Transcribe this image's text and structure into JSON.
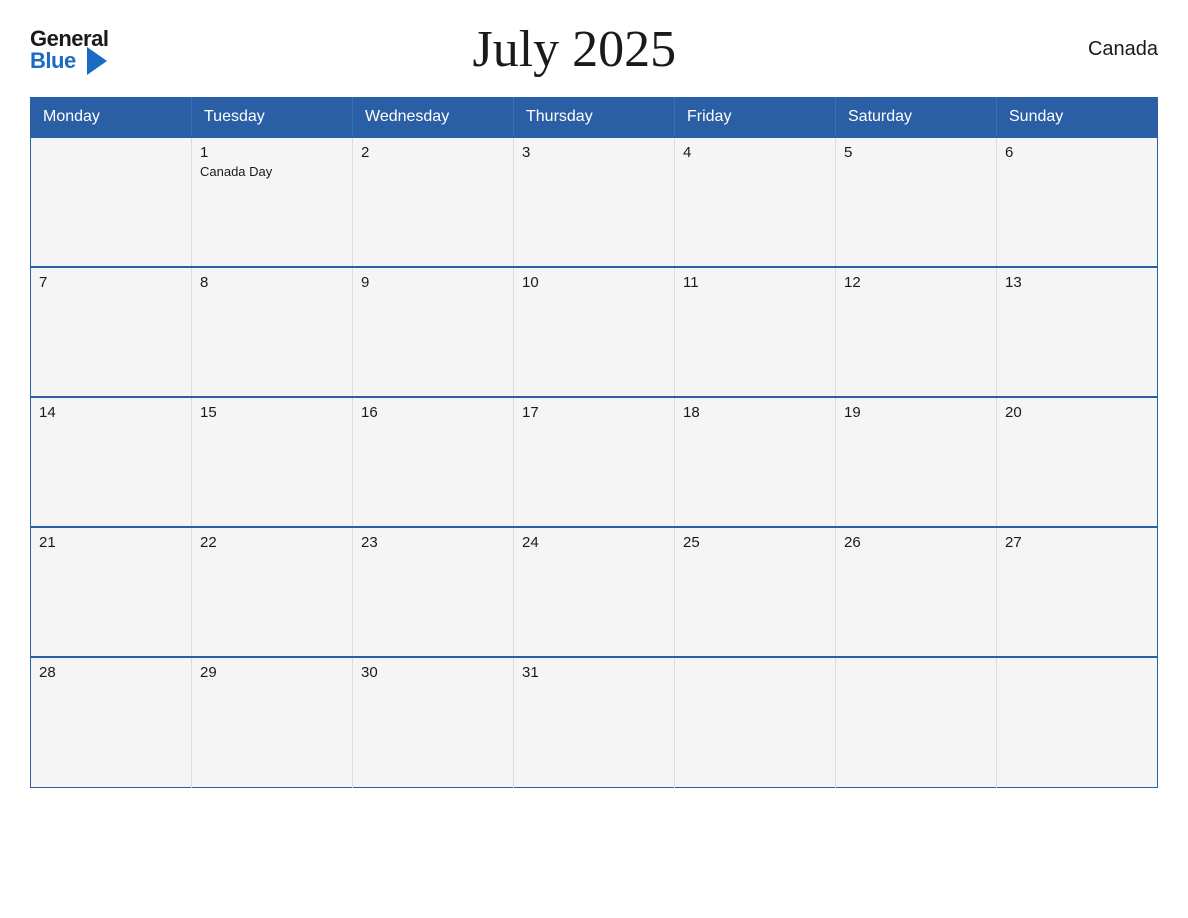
{
  "header": {
    "logo_general": "General",
    "logo_blue": "Blue",
    "month_title": "July 2025",
    "country": "Canada"
  },
  "calendar": {
    "days_of_week": [
      "Monday",
      "Tuesday",
      "Wednesday",
      "Thursday",
      "Friday",
      "Saturday",
      "Sunday"
    ],
    "weeks": [
      [
        {
          "day": "",
          "holiday": ""
        },
        {
          "day": "1",
          "holiday": "Canada Day"
        },
        {
          "day": "2",
          "holiday": ""
        },
        {
          "day": "3",
          "holiday": ""
        },
        {
          "day": "4",
          "holiday": ""
        },
        {
          "day": "5",
          "holiday": ""
        },
        {
          "day": "6",
          "holiday": ""
        }
      ],
      [
        {
          "day": "7",
          "holiday": ""
        },
        {
          "day": "8",
          "holiday": ""
        },
        {
          "day": "9",
          "holiday": ""
        },
        {
          "day": "10",
          "holiday": ""
        },
        {
          "day": "11",
          "holiday": ""
        },
        {
          "day": "12",
          "holiday": ""
        },
        {
          "day": "13",
          "holiday": ""
        }
      ],
      [
        {
          "day": "14",
          "holiday": ""
        },
        {
          "day": "15",
          "holiday": ""
        },
        {
          "day": "16",
          "holiday": ""
        },
        {
          "day": "17",
          "holiday": ""
        },
        {
          "day": "18",
          "holiday": ""
        },
        {
          "day": "19",
          "holiday": ""
        },
        {
          "day": "20",
          "holiday": ""
        }
      ],
      [
        {
          "day": "21",
          "holiday": ""
        },
        {
          "day": "22",
          "holiday": ""
        },
        {
          "day": "23",
          "holiday": ""
        },
        {
          "day": "24",
          "holiday": ""
        },
        {
          "day": "25",
          "holiday": ""
        },
        {
          "day": "26",
          "holiday": ""
        },
        {
          "day": "27",
          "holiday": ""
        }
      ],
      [
        {
          "day": "28",
          "holiday": ""
        },
        {
          "day": "29",
          "holiday": ""
        },
        {
          "day": "30",
          "holiday": ""
        },
        {
          "day": "31",
          "holiday": ""
        },
        {
          "day": "",
          "holiday": ""
        },
        {
          "day": "",
          "holiday": ""
        },
        {
          "day": "",
          "holiday": ""
        }
      ]
    ]
  }
}
